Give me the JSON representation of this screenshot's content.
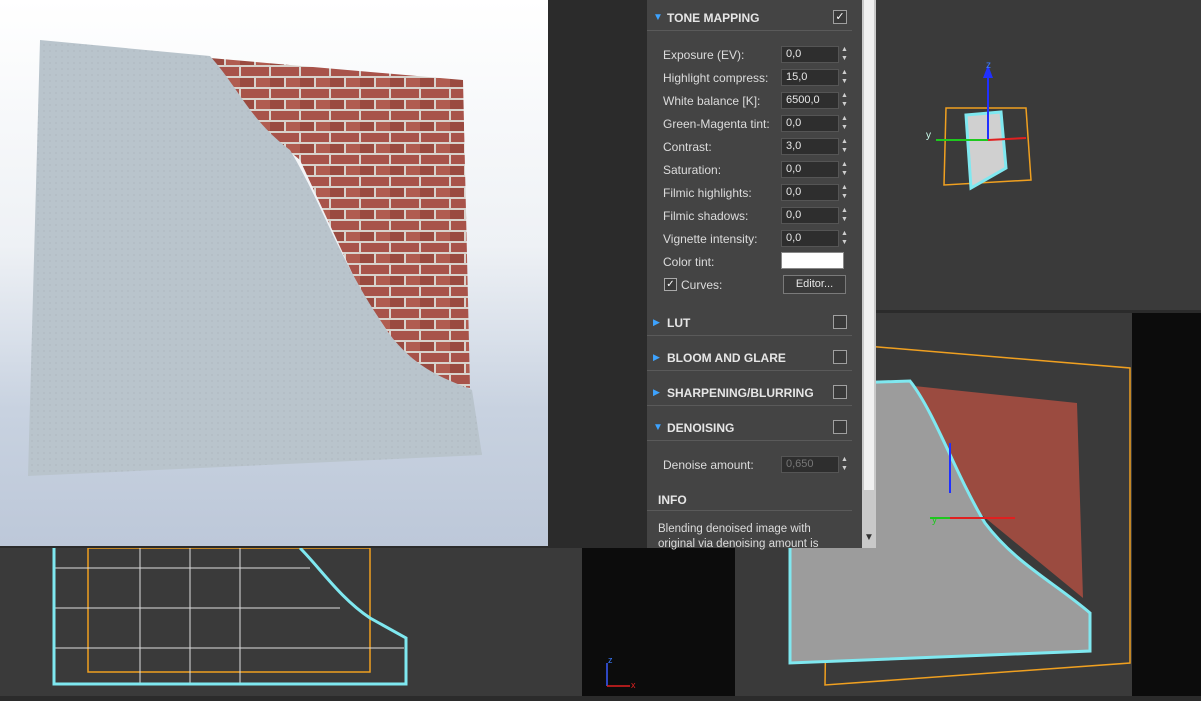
{
  "tone_mapping": {
    "title": "TONE MAPPING",
    "enabled_mark": "✓",
    "fields": [
      {
        "label": "Exposure (EV):",
        "value": "0,0"
      },
      {
        "label": "Highlight compress:",
        "value": "15,0"
      },
      {
        "label": "White balance [K]:",
        "value": "6500,0"
      },
      {
        "label": "Green-Magenta tint:",
        "value": "0,0"
      },
      {
        "label": "Contrast:",
        "value": "3,0"
      },
      {
        "label": "Saturation:",
        "value": "0,0"
      },
      {
        "label": "Filmic highlights:",
        "value": "0,0"
      },
      {
        "label": "Filmic shadows:",
        "value": "0,0"
      },
      {
        "label": "Vignette intensity:",
        "value": "0,0"
      }
    ],
    "color_tint_label": "Color tint:",
    "color_tint_value": "#ffffff",
    "curves_label": "Curves:",
    "curves_checked_mark": "✓",
    "editor_button": "Editor..."
  },
  "sections": {
    "lut": "LUT",
    "bloom": "BLOOM AND GLARE",
    "sharpen": "SHARPENING/BLURRING",
    "denoise": "DENOISING"
  },
  "denoise": {
    "label": "Denoise amount:",
    "value": "0,650"
  },
  "info": {
    "title": "INFO",
    "text": "Blending denoised image with original via denoising amount is"
  },
  "gizmo": {
    "x": "x",
    "y": "y",
    "z": "z"
  },
  "colors": {
    "panel_bg": "#444444",
    "accent_blue": "#3da3ff",
    "selection_cyan": "#7fe8f0",
    "bbox_orange": "#f0a020",
    "brick_red": "#a04a3e"
  }
}
